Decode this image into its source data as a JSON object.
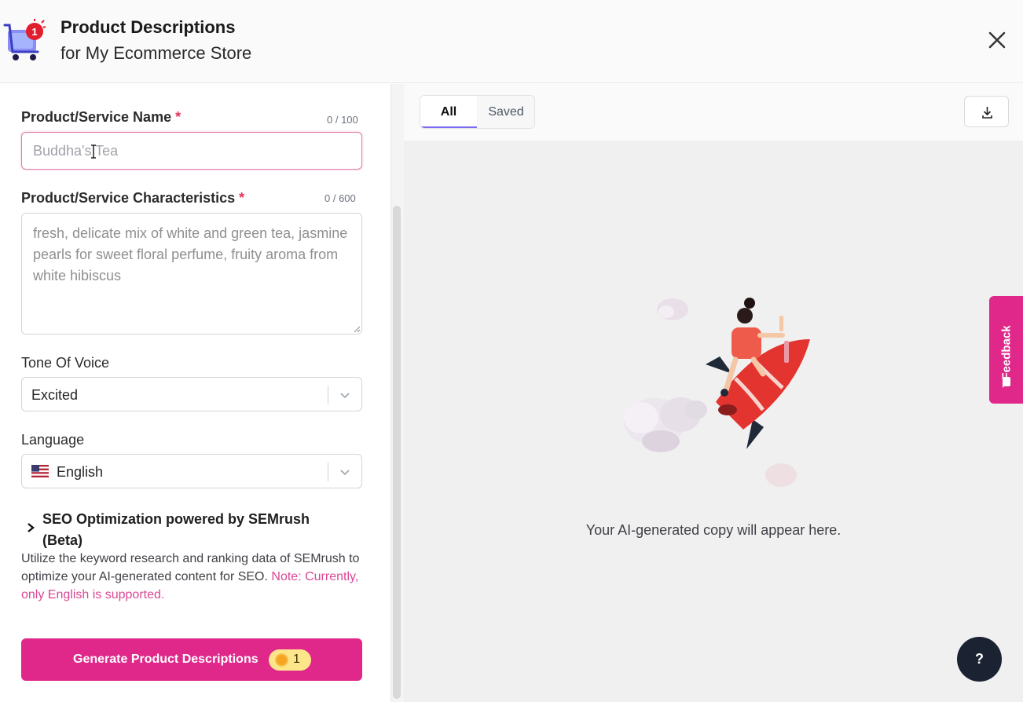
{
  "header": {
    "title": "Product Descriptions",
    "subtitle": "for My Ecommerce Store",
    "logo_icon": "shopping-cart-icon",
    "logo_badge": "1",
    "close_icon": "close-icon"
  },
  "form": {
    "name_field": {
      "label": "Product/Service Name",
      "required_mark": "*",
      "counter": "0 / 100",
      "placeholder": "Buddha's Tea",
      "value": ""
    },
    "characteristics_field": {
      "label": "Product/Service Characteristics",
      "required_mark": "*",
      "counter": "0 / 600",
      "placeholder": "fresh, delicate mix of white and green tea, jasmine pearls for sweet floral perfume, fruity aroma from white hibiscus",
      "value": ""
    },
    "tone": {
      "label": "Tone Of Voice",
      "selected": "Excited"
    },
    "language": {
      "label": "Language",
      "selected": "English",
      "flag_icon": "us-flag-icon"
    },
    "seo": {
      "title": "SEO Optimization powered by SEMrush (Beta)",
      "description": "Utilize the keyword research and ranking data of SEMrush to optimize your AI-generated content for SEO.",
      "note": "Note: Currently, only English is supported."
    },
    "generate_button": {
      "label": "Generate Product Descriptions",
      "credit_count": "1"
    }
  },
  "output": {
    "tabs": [
      {
        "label": "All",
        "active": true
      },
      {
        "label": "Saved",
        "active": false
      }
    ],
    "download_icon": "download-icon",
    "empty_message": "Your AI-generated copy will appear here."
  },
  "feedback": {
    "label": "Feedback"
  },
  "help": {
    "label": "?"
  },
  "colors": {
    "brand_pink": "#e0288b",
    "tab_active_underline": "#7c6cf0",
    "help_button": "#1b2333",
    "required": "#e5345b"
  }
}
